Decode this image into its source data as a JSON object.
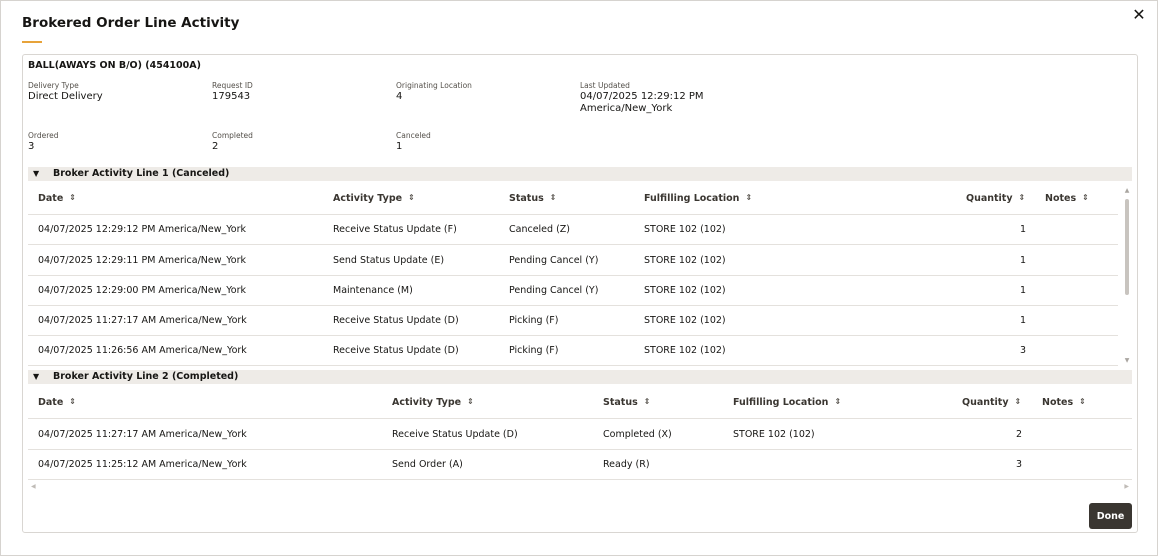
{
  "dialog": {
    "title": "Brokered Order Line Activity",
    "close_glyph": "✕",
    "done_label": "Done"
  },
  "item": {
    "title": "BALL(AWAYS ON B/O) (454100A)",
    "delivery_type_label": "Delivery Type",
    "delivery_type": "Direct Delivery",
    "request_id_label": "Request ID",
    "request_id": "179543",
    "originating_location_label": "Originating Location",
    "originating_location": "4",
    "last_updated_label": "Last Updated",
    "last_updated_line1": "04/07/2025 12:29:12 PM",
    "last_updated_line2": "America/New_York",
    "ordered_label": "Ordered",
    "ordered": "3",
    "completed_label": "Completed",
    "completed": "2",
    "canceled_label": "Canceled",
    "canceled": "1"
  },
  "columns": {
    "date": "Date",
    "activity_type": "Activity Type",
    "status": "Status",
    "fulfilling_location": "Fulfilling Location",
    "quantity": "Quantity",
    "notes": "Notes"
  },
  "line1": {
    "label": "Broker Activity Line 1 (Canceled)",
    "rows": [
      {
        "date": "04/07/2025 12:29:12 PM America/New_York",
        "activity": "Receive Status Update (F)",
        "status": "Canceled (Z)",
        "location": "STORE 102 (102)",
        "quantity": "1",
        "notes": ""
      },
      {
        "date": "04/07/2025 12:29:11 PM America/New_York",
        "activity": "Send Status Update (E)",
        "status": "Pending Cancel (Y)",
        "location": "STORE 102 (102)",
        "quantity": "1",
        "notes": ""
      },
      {
        "date": "04/07/2025 12:29:00 PM America/New_York",
        "activity": "Maintenance (M)",
        "status": "Pending Cancel (Y)",
        "location": "STORE 102 (102)",
        "quantity": "1",
        "notes": ""
      },
      {
        "date": "04/07/2025 11:27:17 AM America/New_York",
        "activity": "Receive Status Update (D)",
        "status": "Picking (F)",
        "location": "STORE 102 (102)",
        "quantity": "1",
        "notes": ""
      },
      {
        "date": "04/07/2025 11:26:56 AM America/New_York",
        "activity": "Receive Status Update (D)",
        "status": "Picking (F)",
        "location": "STORE 102 (102)",
        "quantity": "3",
        "notes": ""
      }
    ]
  },
  "line2": {
    "label": "Broker Activity Line 2 (Completed)",
    "rows": [
      {
        "date": "04/07/2025 11:27:17 AM America/New_York",
        "activity": "Receive Status Update (D)",
        "status": "Completed (X)",
        "location": "STORE 102 (102)",
        "quantity": "2",
        "notes": ""
      },
      {
        "date": "04/07/2025 11:25:12 AM America/New_York",
        "activity": "Send Order (A)",
        "status": "Ready (R)",
        "location": "",
        "quantity": "3",
        "notes": ""
      }
    ]
  },
  "icons": {
    "collapse": "chevron-down-icon",
    "sort": "sort-icon",
    "close": "close-icon"
  }
}
